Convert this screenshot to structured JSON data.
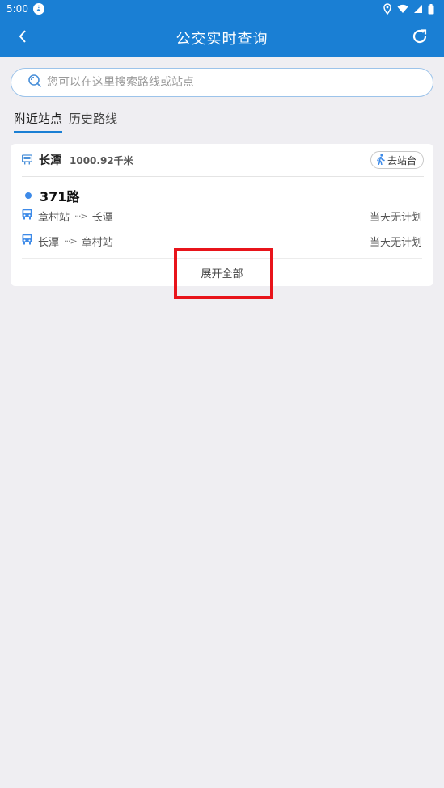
{
  "status_bar": {
    "time": "5:00",
    "download_badge": "⇣"
  },
  "app_bar": {
    "title": "公交实时查询"
  },
  "search": {
    "placeholder": "您可以在这里搜索路线或站点"
  },
  "tabs": [
    {
      "label": "附近站点",
      "active": true
    },
    {
      "label": "历史路线",
      "active": false
    }
  ],
  "nearby": {
    "station_name": "长潭",
    "distance": "1000.92千米",
    "goto_label": "去站台",
    "route": {
      "name": "371路",
      "directions": [
        {
          "from": "章村站",
          "arrow": "···>",
          "to": "长潭",
          "status": "当天无计划"
        },
        {
          "from": "长潭",
          "arrow": "···>",
          "to": "章村站",
          "status": "当天无计划"
        }
      ]
    },
    "expand_label": "展开全部"
  },
  "colors": {
    "primary": "#1a7fd4",
    "route_dot": "#3d8ae8",
    "highlight": "#e8141b",
    "background": "#efeef2"
  },
  "icons": [
    "download-icon",
    "location-icon",
    "wifi-icon",
    "signal-icon",
    "battery-icon",
    "back-icon",
    "refresh-icon",
    "search-icon",
    "bus-stop-icon",
    "walk-icon",
    "bus-icon"
  ]
}
